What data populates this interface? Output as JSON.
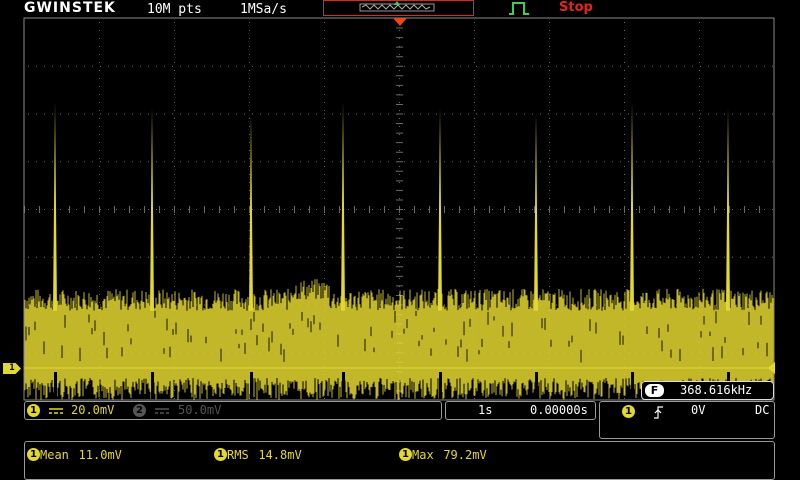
{
  "header": {
    "brand": "GWINSTEK",
    "record_length": "10M pts",
    "sample_rate": "1MSa/s",
    "run_state": "Stop"
  },
  "channel1": {
    "badge": "1",
    "vdiv": "20.0mV",
    "coupling_icon": "dc-coupling-icon",
    "color": "#e3d82f"
  },
  "channel2": {
    "badge": "2",
    "vdiv": "50.0mV",
    "color": "#555555"
  },
  "timebase": {
    "tdiv": "1s",
    "position": "0.00000s"
  },
  "trigger": {
    "source_badge": "1",
    "slope_icon": "rising-edge-icon",
    "level": "0V",
    "coupling": "DC",
    "status_icon": "pulse-trigger-icon"
  },
  "frequency": {
    "badge": "F",
    "value": "368.616kHz"
  },
  "measurements": [
    {
      "badge": "1",
      "label": "Mean",
      "value": "11.0mV"
    },
    {
      "badge": "1",
      "label": "RMS",
      "value": "14.8mV"
    },
    {
      "badge": "1",
      "label": "Max",
      "value": "79.2mV"
    }
  ],
  "colors": {
    "channel1": "#e3d82f",
    "stop": "#e0271e",
    "trigger_marker": "#e84a1e",
    "grid_dot": "#6a6a6a"
  },
  "waveform": {
    "noise_level_frac": 0.15,
    "spike_level_frac": 0.78
  }
}
